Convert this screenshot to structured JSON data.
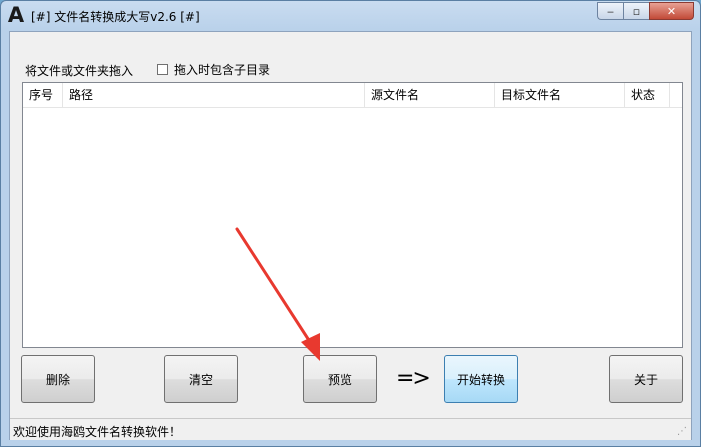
{
  "window": {
    "logo_letter": "A",
    "title": "[#] 文件名转换成大写v2.6 [#]",
    "minimize_glyph": "‒",
    "maximize_glyph": "▫",
    "close_glyph": "✕"
  },
  "toolbar": {
    "drop_hint": "将文件或文件夹拖入",
    "include_subdirs_label": "拖入时包含子目录",
    "include_subdirs_checked": false
  },
  "list": {
    "columns": [
      "序号",
      "路径",
      "源文件名",
      "目标文件名",
      "状态"
    ],
    "rows": []
  },
  "buttons": {
    "delete": "删除",
    "clear": "清空",
    "preview": "预览",
    "arrow_sign": "=>",
    "start": "开始转换",
    "about": "关于"
  },
  "statusbar": {
    "text": "欢迎使用海鸥文件名转换软件！"
  },
  "colors": {
    "annotation_arrow": "#e8392f",
    "title_gradient": "#b9d1ea",
    "start_button_border": "#3c7fb1"
  }
}
